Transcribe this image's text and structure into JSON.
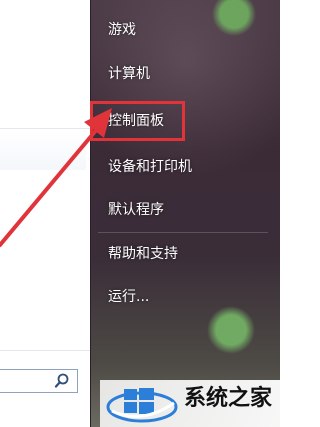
{
  "right_menu": {
    "items": [
      {
        "label": "游戏"
      },
      {
        "label": "计算机"
      },
      {
        "label": "控制面板"
      },
      {
        "label": "设备和打印机"
      },
      {
        "label": "默认程序"
      },
      {
        "label": "帮助和支持"
      },
      {
        "label": "运行..."
      }
    ]
  },
  "search": {
    "icon": "search-icon"
  },
  "annotation": {
    "highlight_color": "#e0333a",
    "arrow_color": "#e0333a"
  },
  "watermark": {
    "text": "系统之家",
    "logo_icon": "windows-logo-icon"
  }
}
